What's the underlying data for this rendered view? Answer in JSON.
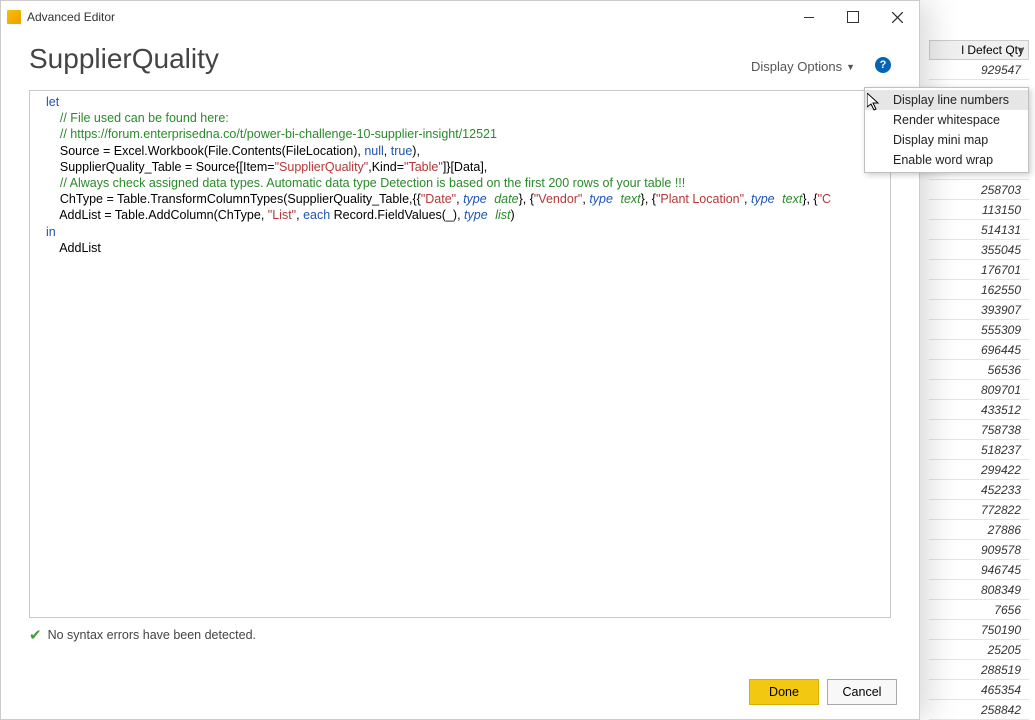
{
  "window": {
    "title": "Advanced Editor"
  },
  "query_name": "SupplierQuality",
  "display_options": {
    "label": "Display Options"
  },
  "dropdown": {
    "items": [
      "Display line numbers",
      "Render whitespace",
      "Display mini map",
      "Enable word wrap"
    ]
  },
  "code": {
    "l1": "let",
    "l2_c": "    // File used can be found here:",
    "l3_c": "    // https://forum.enterprisedna.co/t/power-bi-challenge-10-supplier-insight/12521",
    "l4a": "    Source = Excel.Workbook(File.Contents(FileLocation), ",
    "l4_null": "null",
    "l4b": ", ",
    "l4_true": "true",
    "l4c": "),",
    "l5a": "    SupplierQuality_Table = Source{[Item=",
    "l5_s1": "\"SupplierQuality\"",
    "l5b": ",Kind=",
    "l5_s2": "\"Table\"",
    "l5c": "]}[Data],",
    "l6_c": "    // Always check assigned data types. Automatic data type Detection is based on the first 200 rows of your table !!!",
    "l7a": "    ChType = Table.TransformColumnTypes(SupplierQuality_Table,{{",
    "l7_s1": "\"Date\"",
    "l7b": ", ",
    "l7_t": "type",
    "l7_tn1": "date",
    "l7c": "}, {",
    "l7_s2": "\"Vendor\"",
    "l7d": ", ",
    "l7_tn2": "text",
    "l7e": "}, {",
    "l7_s3": "\"Plant Location\"",
    "l7f": ", ",
    "l7_tn3": "text",
    "l7g": "}, {",
    "l7_s4": "\"C",
    "l8a": "    AddList = Table.AddColumn(ChType, ",
    "l8_s1": "\"List\"",
    "l8b": ", ",
    "l8_kw": "each",
    "l8c": " Record.FieldValues(_), ",
    "l8_tn": "list",
    "l8d": ")",
    "l9": "in",
    "l10": "    AddList"
  },
  "status": {
    "text": "No syntax errors have been detected."
  },
  "buttons": {
    "done": "Done",
    "cancel": "Cancel"
  },
  "background_column": {
    "header": "l Defect Qty",
    "values": [
      "929547",
      "",
      "",
      "",
      "",
      "",
      "258703",
      "113150",
      "514131",
      "355045",
      "176701",
      "162550",
      "393907",
      "555309",
      "696445",
      "56536",
      "809701",
      "433512",
      "758738",
      "518237",
      "299422",
      "452233",
      "772822",
      "27886",
      "909578",
      "946745",
      "808349",
      "7656",
      "750190",
      "25205",
      "288519",
      "465354",
      "258842"
    ]
  }
}
